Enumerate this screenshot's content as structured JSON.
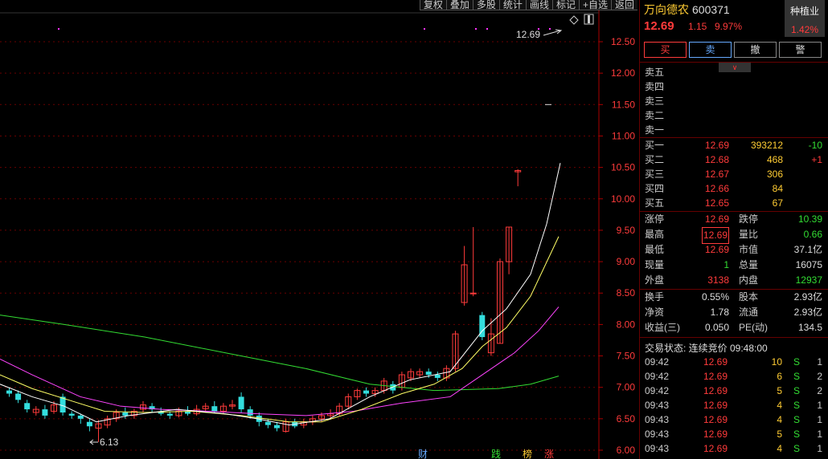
{
  "toolbar": [
    "复权",
    "叠加",
    "多股",
    "统计",
    "画线",
    "标记",
    "+自选",
    "返回"
  ],
  "chart": {
    "y_ticks": [
      "12.50",
      "12.00",
      "11.50",
      "11.00",
      "10.50",
      "10.00",
      "9.50",
      "9.00",
      "8.50",
      "8.00",
      "7.50",
      "7.00",
      "6.50",
      "6.00"
    ],
    "high_label": "12.69",
    "low_label": "6.13",
    "markers": [
      {
        "text": "财",
        "color": "#66aaff"
      },
      {
        "text": "践",
        "color": "#33dd33"
      },
      {
        "text": "榜",
        "color": "#ffcc33"
      },
      {
        "text": "涨",
        "color": "#ff3b3b"
      }
    ],
    "colors": {
      "up": "#ff3b3b",
      "down": "#33dddd",
      "ma5": "#ffffff",
      "ma10": "#ffff66",
      "ma20": "#ff44ff",
      "ma60": "#33dd33"
    }
  },
  "stock": {
    "name": "万向德农",
    "code": "600371",
    "price": "12.69",
    "change": "1.15",
    "pct": "9.97%",
    "industry": "种植业",
    "industry_pct": "1.42%"
  },
  "trade_buttons": {
    "buy": "买",
    "sell": "卖",
    "cancel": "撤",
    "alert": "警"
  },
  "sell_levels": [
    {
      "label": "卖五",
      "price": "",
      "vol": ""
    },
    {
      "label": "卖四",
      "price": "",
      "vol": ""
    },
    {
      "label": "卖三",
      "price": "",
      "vol": ""
    },
    {
      "label": "卖二",
      "price": "",
      "vol": ""
    },
    {
      "label": "卖一",
      "price": "",
      "vol": ""
    }
  ],
  "buy_levels": [
    {
      "label": "买一",
      "price": "12.69",
      "vol": "393212",
      "chg": "-10"
    },
    {
      "label": "买二",
      "price": "12.68",
      "vol": "468",
      "chg": "+1"
    },
    {
      "label": "买三",
      "price": "12.67",
      "vol": "306",
      "chg": ""
    },
    {
      "label": "买四",
      "price": "12.66",
      "vol": "84",
      "chg": ""
    },
    {
      "label": "买五",
      "price": "12.65",
      "vol": "67",
      "chg": ""
    }
  ],
  "stats1": [
    {
      "l1": "涨停",
      "v1": "12.69",
      "c1": "red",
      "l2": "跌停",
      "v2": "10.39",
      "c2": "grn"
    },
    {
      "l1": "最高",
      "v1": "12.69",
      "c1": "red",
      "l2": "量比",
      "v2": "0.66",
      "c2": "grn"
    },
    {
      "l1": "最低",
      "v1": "12.69",
      "c1": "red",
      "l2": "市值",
      "v2": "37.1亿",
      "c2": "wht"
    },
    {
      "l1": "现量",
      "v1": "1",
      "c1": "grn",
      "l2": "总量",
      "v2": "16075",
      "c2": "wht"
    },
    {
      "l1": "外盘",
      "v1": "3138",
      "c1": "red",
      "l2": "内盘",
      "v2": "12937",
      "c2": "grn"
    }
  ],
  "stats2": [
    {
      "l1": "换手",
      "v1": "0.55%",
      "c1": "wht",
      "l2": "股本",
      "v2": "2.93亿",
      "c2": "wht"
    },
    {
      "l1": "净资",
      "v1": "1.78",
      "c1": "wht",
      "l2": "流通",
      "v2": "2.93亿",
      "c2": "wht"
    },
    {
      "l1": "收益(三)",
      "v1": "0.050",
      "c1": "wht",
      "l2": "PE(动)",
      "v2": "134.5",
      "c2": "wht"
    }
  ],
  "status": "交易状态: 连续竞价 09:48:00",
  "ticks": [
    {
      "t": "09:42",
      "p": "12.69",
      "v": "10",
      "s": "S",
      "c": "1"
    },
    {
      "t": "09:42",
      "p": "12.69",
      "v": "6",
      "s": "S",
      "c": "2"
    },
    {
      "t": "09:42",
      "p": "12.69",
      "v": "5",
      "s": "S",
      "c": "2"
    },
    {
      "t": "09:43",
      "p": "12.69",
      "v": "4",
      "s": "S",
      "c": "1"
    },
    {
      "t": "09:43",
      "p": "12.69",
      "v": "4",
      "s": "S",
      "c": "1"
    },
    {
      "t": "09:43",
      "p": "12.69",
      "v": "5",
      "s": "S",
      "c": "1"
    },
    {
      "t": "09:43",
      "p": "12.69",
      "v": "4",
      "s": "S",
      "c": "1"
    }
  ]
}
